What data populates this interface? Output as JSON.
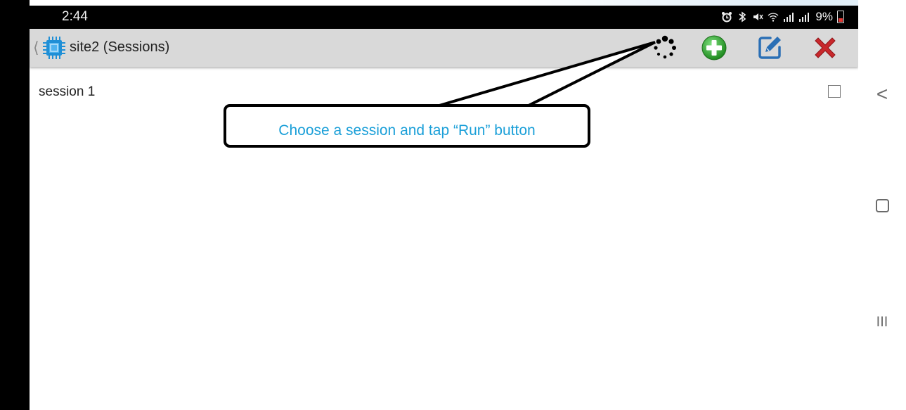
{
  "status_bar": {
    "time": "2:44",
    "battery": "9%",
    "icons": [
      "alarm-icon",
      "bluetooth-icon",
      "mute-icon",
      "wifi-icon",
      "signal-icon",
      "signal-icon-2",
      "battery-icon"
    ]
  },
  "action_bar": {
    "title": "site2 (Sessions)",
    "app_icon": "chip-icon",
    "buttons": [
      {
        "name": "run",
        "icon": "run-spinner-icon"
      },
      {
        "name": "add",
        "icon": "plus-circle-icon",
        "color": "#2e9e2e"
      },
      {
        "name": "edit",
        "icon": "edit-icon",
        "color": "#2a6fb5"
      },
      {
        "name": "delete",
        "icon": "close-x-icon",
        "color": "#c8282c"
      }
    ]
  },
  "sessions": [
    {
      "label": "session 1",
      "checked": false
    }
  ],
  "callout": {
    "text": "Choose a session and tap “Run” button",
    "color": "#1a9fd8"
  },
  "nav_bar": {
    "back": "<",
    "recents": "III"
  }
}
